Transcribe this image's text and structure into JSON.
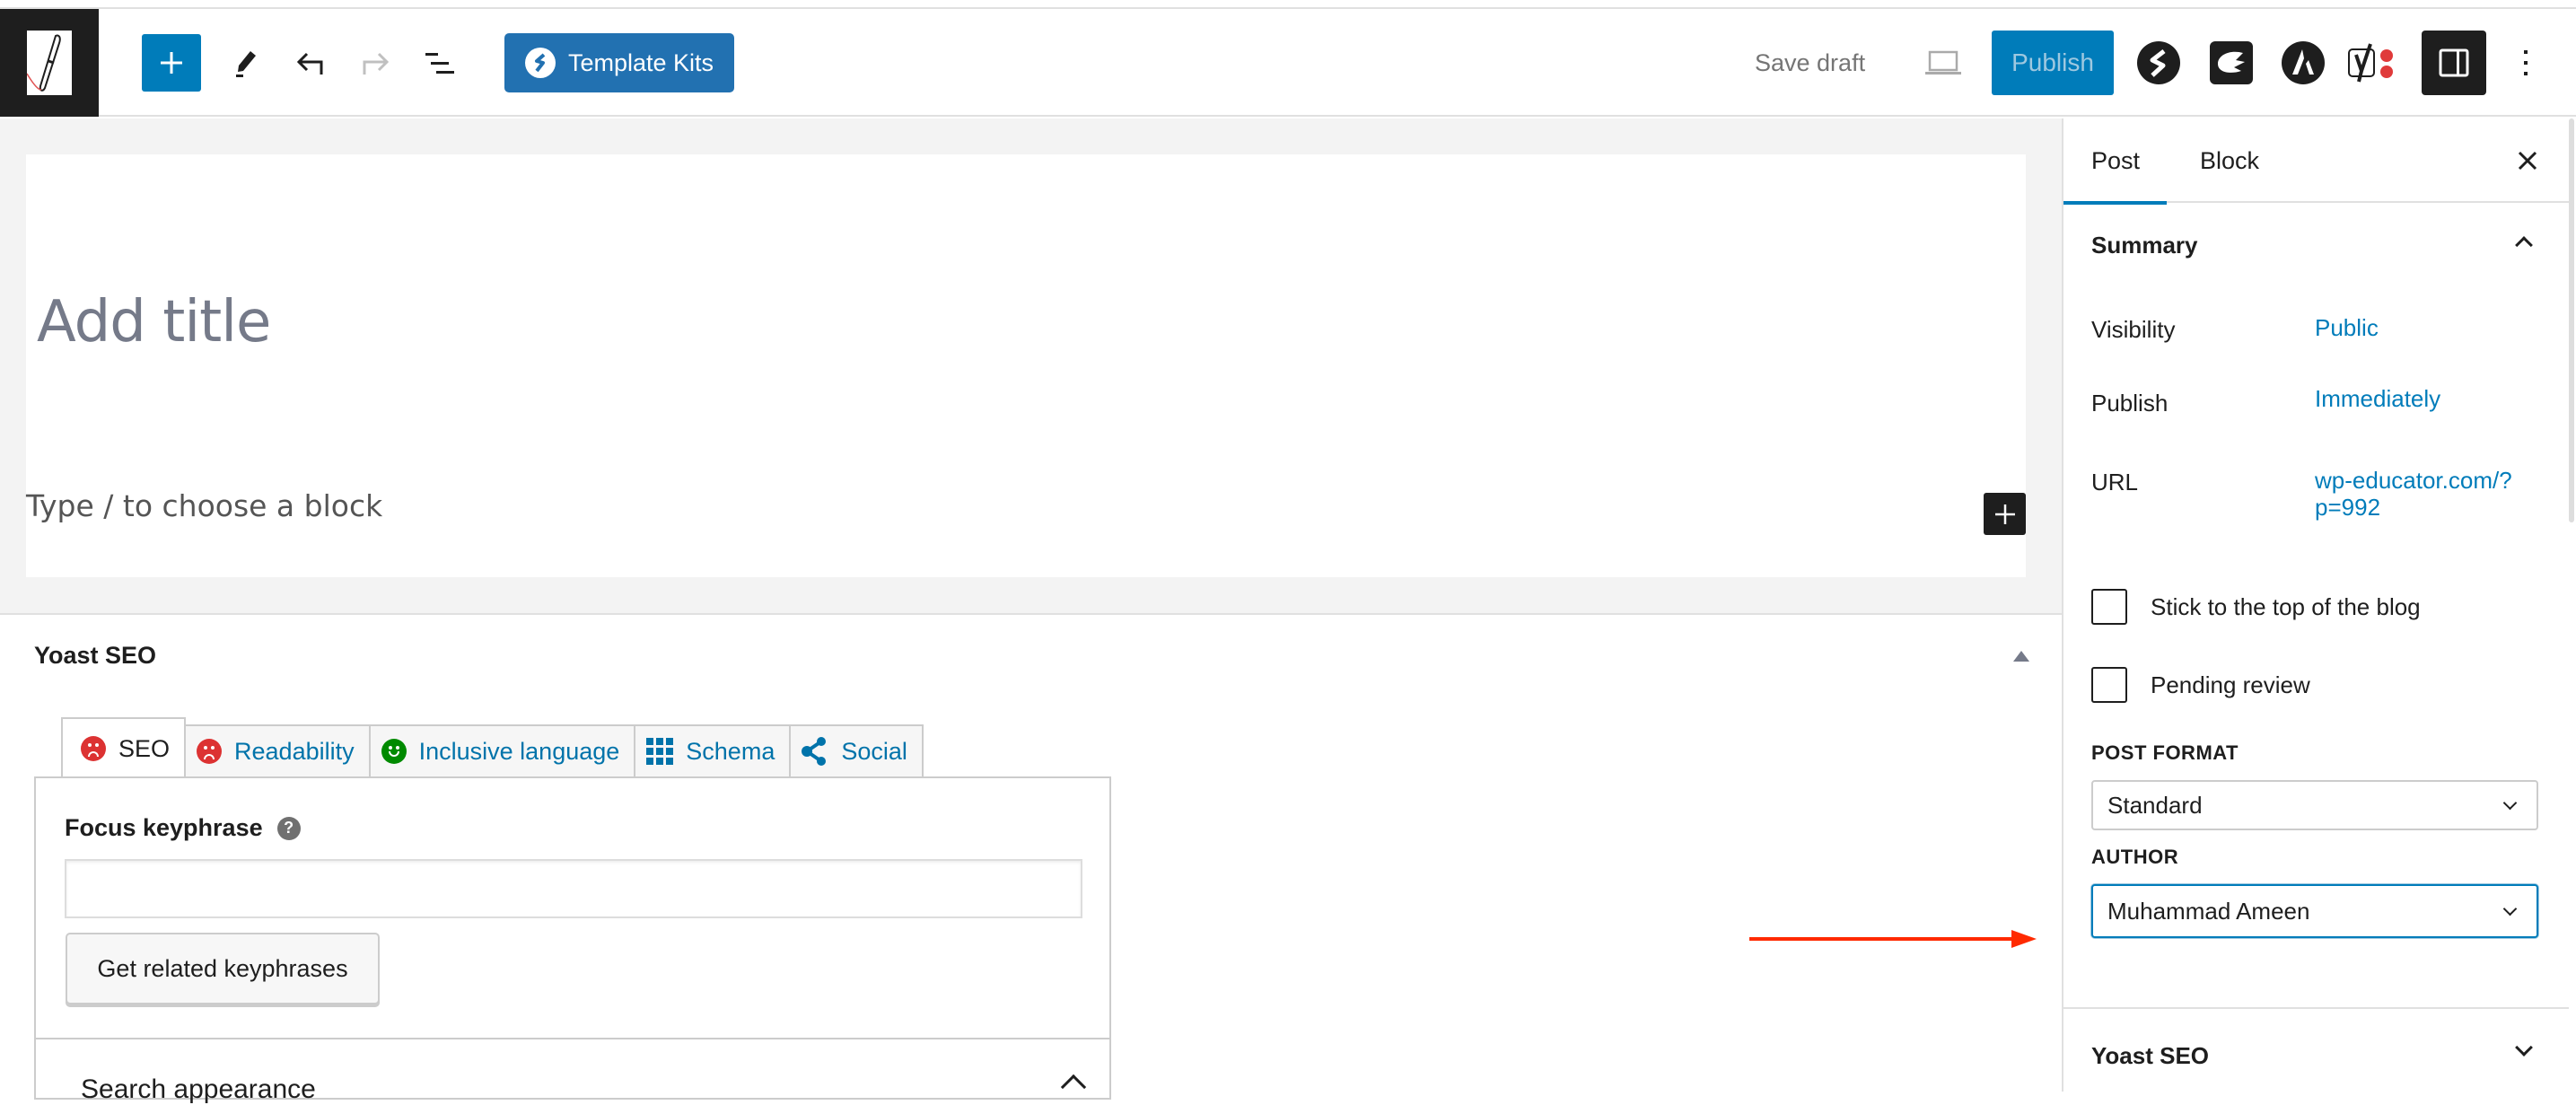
{
  "toolbar": {
    "site_logo_icon": "pen-logo-icon",
    "inserter_icon": "plus-icon",
    "tools_icon": "pencil-icon",
    "undo_icon": "undo-icon",
    "redo_icon": "redo-icon",
    "list_view_icon": "list-view-icon",
    "template_kits_label": "Template Kits",
    "save_draft_label": "Save draft",
    "preview_icon": "laptop-icon",
    "publish_label": "Publish",
    "plugin_icons": [
      "spectra-icon",
      "elementor-kit-icon",
      "astra-icon",
      "yoast-icon"
    ],
    "settings_icon": "sidebar-toggle-icon",
    "more_icon": "more-vertical-icon"
  },
  "editor": {
    "title_placeholder": "Add title",
    "block_placeholder": "Type / to choose a block"
  },
  "yoast_metabox": {
    "title": "Yoast SEO",
    "tabs": [
      {
        "label": "SEO",
        "icon": "sad-face-icon",
        "status_color": "#dc3232",
        "active": true
      },
      {
        "label": "Readability",
        "icon": "sad-face-icon",
        "status_color": "#dc3232",
        "active": false
      },
      {
        "label": "Inclusive language",
        "icon": "happy-face-icon",
        "status_color": "#008a00",
        "active": false
      },
      {
        "label": "Schema",
        "icon": "grid-icon",
        "active": false
      },
      {
        "label": "Social",
        "icon": "share-icon",
        "active": false
      }
    ],
    "focus_keyphrase_label": "Focus keyphrase",
    "focus_keyphrase_value": "",
    "related_button_label": "Get related keyphrases",
    "search_appearance_label": "Search appearance"
  },
  "sidebar": {
    "tabs": [
      {
        "label": "Post",
        "active": true
      },
      {
        "label": "Block",
        "active": false
      }
    ],
    "summary": {
      "heading": "Summary",
      "rows": [
        {
          "label": "Visibility",
          "value": "Public"
        },
        {
          "label": "Publish",
          "value": "Immediately"
        },
        {
          "label": "URL",
          "value": "wp-educator.com/?p=992"
        }
      ],
      "checkboxes": [
        {
          "label": "Stick to the top of the blog",
          "checked": false
        },
        {
          "label": "Pending review",
          "checked": false
        }
      ],
      "post_format_label": "POST FORMAT",
      "post_format_value": "Standard",
      "author_label": "AUTHOR",
      "author_value": "Muhammad Ameen"
    },
    "yoast_panel_heading": "Yoast SEO"
  },
  "colors": {
    "accent": "#007cba",
    "template_kits_bg": "#2271b1",
    "annotation_arrow": "#ff2a00",
    "error": "#dc3232",
    "good": "#008a00"
  }
}
